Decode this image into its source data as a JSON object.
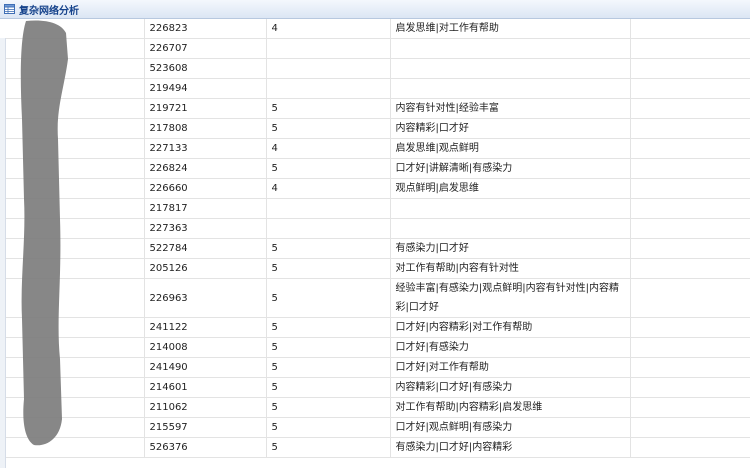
{
  "window": {
    "title": "复杂网络分析",
    "title_icon": "table-grid-icon"
  },
  "rows": [
    {
      "id": "226823",
      "score": "4",
      "comment": "启发思维|对工作有帮助"
    },
    {
      "id": "226707",
      "score": "",
      "comment": ""
    },
    {
      "id": "523608",
      "score": "",
      "comment": ""
    },
    {
      "id": "219494",
      "score": "",
      "comment": ""
    },
    {
      "id": "219721",
      "score": "5",
      "comment": "内容有针对性|经验丰富"
    },
    {
      "id": "217808",
      "score": "5",
      "comment": "内容精彩|口才好"
    },
    {
      "id": "227133",
      "score": "4",
      "comment": "启发思维|观点鲜明"
    },
    {
      "id": "226824",
      "score": "5",
      "comment": "口才好|讲解清晰|有感染力"
    },
    {
      "id": "226660",
      "score": "4",
      "comment": "观点鲜明|启发思维"
    },
    {
      "id": "217817",
      "score": "",
      "comment": ""
    },
    {
      "id": "227363",
      "score": "",
      "comment": ""
    },
    {
      "id": "522784",
      "score": "5",
      "comment": "有感染力|口才好"
    },
    {
      "id": "205126",
      "score": "5",
      "comment": "对工作有帮助|内容有针对性"
    },
    {
      "id": "226963",
      "score": "5",
      "comment": "经验丰富|有感染力|观点鲜明|内容有针对性|内容精彩|口才好"
    },
    {
      "id": "241122",
      "score": "5",
      "comment": "口才好|内容精彩|对工作有帮助"
    },
    {
      "id": "214008",
      "score": "5",
      "comment": "口才好|有感染力"
    },
    {
      "id": "241490",
      "score": "5",
      "comment": "口才好|对工作有帮助"
    },
    {
      "id": "214601",
      "score": "5",
      "comment": "内容精彩|口才好|有感染力"
    },
    {
      "id": "211062",
      "score": "5",
      "comment": "对工作有帮助|内容精彩|启发思维"
    },
    {
      "id": "215597",
      "score": "5",
      "comment": "口才好|观点鲜明|有感染力"
    },
    {
      "id": "526376",
      "score": "5",
      "comment": "有感染力|口才好|内容精彩"
    }
  ],
  "colors": {
    "title_text": "#15428b",
    "grid_line": "#e3e3e3",
    "mask": "#7a7a7a"
  }
}
